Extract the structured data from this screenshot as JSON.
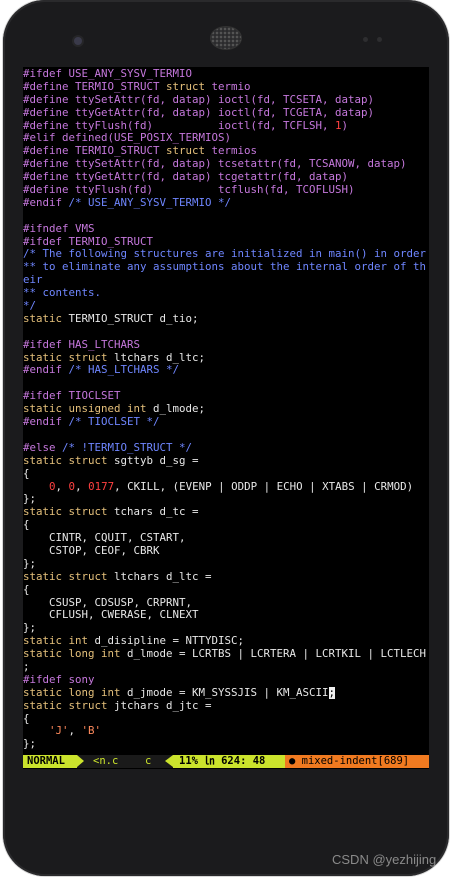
{
  "code_lines": [
    [
      {
        "c": "pp",
        "t": "#ifdef USE_ANY_SYSV_TERMIO"
      }
    ],
    [
      {
        "c": "pp",
        "t": "#define TERMIO_STRUCT "
      },
      {
        "c": "kw",
        "t": "struct"
      },
      {
        "c": "pp",
        "t": " termio"
      }
    ],
    [
      {
        "c": "pp",
        "t": "#define ttySetAttr(fd, datap) ioctl(fd, TCSETA, datap)"
      }
    ],
    [
      {
        "c": "pp",
        "t": "#define ttyGetAttr(fd, datap) ioctl(fd, TCGETA, datap)"
      }
    ],
    [
      {
        "c": "pp",
        "t": "#define ttyFlush(fd)          ioctl(fd, TCFLSH, "
      },
      {
        "c": "nu",
        "t": "1"
      },
      {
        "c": "pp",
        "t": ")"
      }
    ],
    [
      {
        "c": "pp",
        "t": "#elif defined(USE_POSIX_TERMIOS)"
      }
    ],
    [
      {
        "c": "pp",
        "t": "#define TERMIO_STRUCT "
      },
      {
        "c": "kw",
        "t": "struct"
      },
      {
        "c": "pp",
        "t": " termios"
      }
    ],
    [
      {
        "c": "pp",
        "t": "#define ttySetAttr(fd, datap) tcsetattr(fd, TCSANOW, datap)"
      }
    ],
    [
      {
        "c": "pp",
        "t": "#define ttyGetAttr(fd, datap) tcgetattr(fd, datap)"
      }
    ],
    [
      {
        "c": "pp",
        "t": "#define ttyFlush(fd)          tcflush(fd, TCOFLUSH)"
      }
    ],
    [
      {
        "c": "pp",
        "t": "#endif "
      },
      {
        "c": "cm",
        "t": "/* USE_ANY_SYSV_TERMIO */"
      }
    ],
    [
      {
        "c": "tx",
        "t": ""
      }
    ],
    [
      {
        "c": "pp",
        "t": "#ifndef VMS"
      }
    ],
    [
      {
        "c": "pp",
        "t": "#ifdef TERMIO_STRUCT"
      }
    ],
    [
      {
        "c": "cm",
        "t": "/* The following structures are initialized in main() in order"
      }
    ],
    [
      {
        "c": "cm",
        "t": "** to eliminate any assumptions about the internal order of th"
      }
    ],
    [
      {
        "c": "cm",
        "t": "eir"
      }
    ],
    [
      {
        "c": "cm",
        "t": "** contents."
      }
    ],
    [
      {
        "c": "cm",
        "t": "*/"
      }
    ],
    [
      {
        "c": "kw",
        "t": "static"
      },
      {
        "c": "tx",
        "t": " TERMIO_STRUCT d_tio;"
      }
    ],
    [
      {
        "c": "tx",
        "t": ""
      }
    ],
    [
      {
        "c": "pp",
        "t": "#ifdef HAS_LTCHARS"
      }
    ],
    [
      {
        "c": "kw",
        "t": "static struct"
      },
      {
        "c": "tx",
        "t": " ltchars d_ltc;"
      }
    ],
    [
      {
        "c": "pp",
        "t": "#endif "
      },
      {
        "c": "cm",
        "t": "/* HAS_LTCHARS */"
      }
    ],
    [
      {
        "c": "tx",
        "t": ""
      }
    ],
    [
      {
        "c": "pp",
        "t": "#ifdef TIOCLSET"
      }
    ],
    [
      {
        "c": "kw",
        "t": "static unsigned int"
      },
      {
        "c": "tx",
        "t": " d_lmode;"
      }
    ],
    [
      {
        "c": "pp",
        "t": "#endif "
      },
      {
        "c": "cm",
        "t": "/* TIOCLSET */"
      }
    ],
    [
      {
        "c": "tx",
        "t": ""
      }
    ],
    [
      {
        "c": "pp",
        "t": "#else "
      },
      {
        "c": "cm",
        "t": "/* !TERMIO_STRUCT */"
      }
    ],
    [
      {
        "c": "kw",
        "t": "static struct"
      },
      {
        "c": "tx",
        "t": " sgttyb d_sg ="
      }
    ],
    [
      {
        "c": "tx",
        "t": "{"
      }
    ],
    [
      {
        "c": "tx",
        "t": "    "
      },
      {
        "c": "nu",
        "t": "0"
      },
      {
        "c": "tx",
        "t": ", "
      },
      {
        "c": "nu",
        "t": "0"
      },
      {
        "c": "tx",
        "t": ", "
      },
      {
        "c": "nu",
        "t": "0177"
      },
      {
        "c": "tx",
        "t": ", CKILL, (EVENP | ODDP | ECHO | XTABS | CRMOD)"
      }
    ],
    [
      {
        "c": "tx",
        "t": "};"
      }
    ],
    [
      {
        "c": "kw",
        "t": "static struct"
      },
      {
        "c": "tx",
        "t": " tchars d_tc ="
      }
    ],
    [
      {
        "c": "tx",
        "t": "{"
      }
    ],
    [
      {
        "c": "tx",
        "t": "    CINTR, CQUIT, CSTART,"
      }
    ],
    [
      {
        "c": "tx",
        "t": "    CSTOP, CEOF, CBRK"
      }
    ],
    [
      {
        "c": "tx",
        "t": "};"
      }
    ],
    [
      {
        "c": "kw",
        "t": "static struct"
      },
      {
        "c": "tx",
        "t": " ltchars d_ltc ="
      }
    ],
    [
      {
        "c": "tx",
        "t": "{"
      }
    ],
    [
      {
        "c": "tx",
        "t": "    CSUSP, CDSUSP, CRPRNT,"
      }
    ],
    [
      {
        "c": "tx",
        "t": "    CFLUSH, CWERASE, CLNEXT"
      }
    ],
    [
      {
        "c": "tx",
        "t": "};"
      }
    ],
    [
      {
        "c": "kw",
        "t": "static int"
      },
      {
        "c": "tx",
        "t": " d_disipline = NTTYDISC;"
      }
    ],
    [
      {
        "c": "kw",
        "t": "static long int"
      },
      {
        "c": "tx",
        "t": " d_lmode = LCRTBS | LCRTERA | LCRTKIL | LCTLECH"
      }
    ],
    [
      {
        "c": "tx",
        "t": ";"
      }
    ],
    [
      {
        "c": "pp",
        "t": "#ifdef sony"
      }
    ],
    [
      {
        "c": "kw",
        "t": "static long int"
      },
      {
        "c": "tx",
        "t": " d_jmode = KM_SYSSJIS | KM_ASCII"
      },
      {
        "c": "cur",
        "t": ";"
      }
    ],
    [
      {
        "c": "kw",
        "t": "static struct"
      },
      {
        "c": "tx",
        "t": " jtchars d_jtc ="
      }
    ],
    [
      {
        "c": "tx",
        "t": "{"
      }
    ],
    [
      {
        "c": "tx",
        "t": "    "
      },
      {
        "c": "st",
        "t": "'J'"
      },
      {
        "c": "tx",
        "t": ", "
      },
      {
        "c": "st",
        "t": "'B'"
      }
    ],
    [
      {
        "c": "tx",
        "t": "};"
      }
    ]
  ],
  "statusbar": {
    "mode": "NORMAL",
    "file": "<n.c",
    "filetype": "c",
    "position": "11% ㏑ 624: 48",
    "warning": "● mixed-indent[689]"
  },
  "watermark": "CSDN @yezhijing"
}
